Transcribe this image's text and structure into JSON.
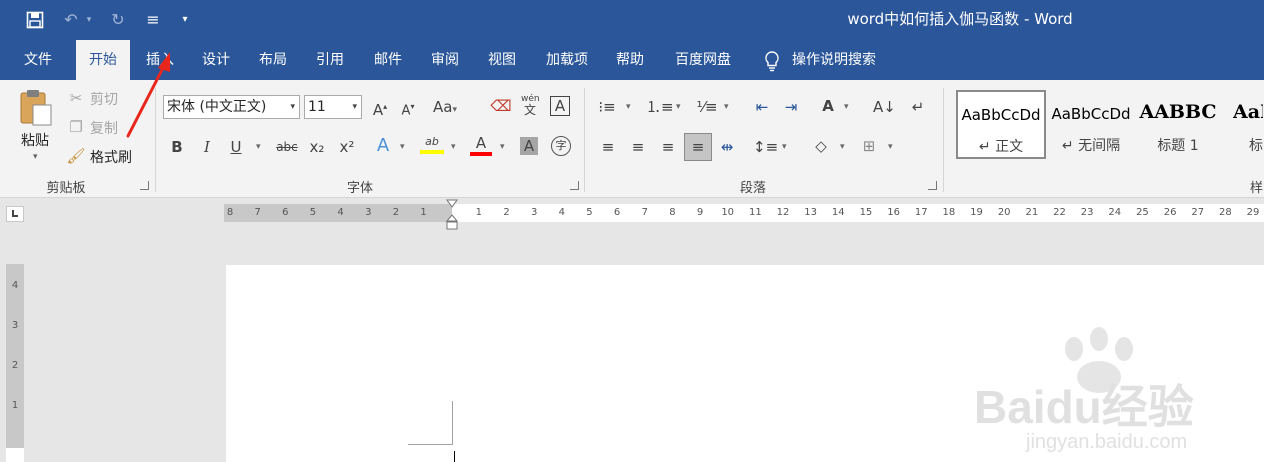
{
  "window": {
    "title": "word中如何插入伽马函数  -  Word"
  },
  "tabs": [
    {
      "label": "文件"
    },
    {
      "label": "开始"
    },
    {
      "label": "插入"
    },
    {
      "label": "设计"
    },
    {
      "label": "布局"
    },
    {
      "label": "引用"
    },
    {
      "label": "邮件"
    },
    {
      "label": "审阅"
    },
    {
      "label": "视图"
    },
    {
      "label": "加载项"
    },
    {
      "label": "帮助"
    },
    {
      "label": "百度网盘"
    }
  ],
  "search": {
    "label": "操作说明搜索",
    "icon": "lightbulb-icon"
  },
  "clipboard": {
    "group_label": "剪贴板",
    "paste": "粘贴",
    "cut": "剪切",
    "copy": "复制",
    "format_painter": "格式刷"
  },
  "font": {
    "group_label": "字体",
    "font_name": "宋体 (中文正文)",
    "font_size": "11",
    "grow": "A",
    "shrink": "A",
    "change_case": "Aa",
    "phonetic_top": "wén",
    "phonetic_bottom": "文",
    "border_char": "A",
    "bold": "B",
    "italic": "I",
    "underline": "U",
    "strike": "abc",
    "subscript": "x₂",
    "superscript": "x²",
    "text_effects": "A",
    "highlight": "ab",
    "font_color": "A",
    "char_shading": "A",
    "enclose": "字"
  },
  "paragraph": {
    "group_label": "段落"
  },
  "styles": {
    "group_label": "样",
    "items": [
      {
        "sample": "AaBbCcDd",
        "name": "↵ 正文"
      },
      {
        "sample": "AaBbCcDd",
        "name": "↵ 无间隔"
      },
      {
        "sample": "AABBC",
        "name": "标题 1"
      },
      {
        "sample": "AaB",
        "name": "标"
      }
    ]
  },
  "hruler": {
    "ticks": [
      "8",
      "7",
      "6",
      "5",
      "4",
      "3",
      "2",
      "1",
      "",
      "1",
      "2",
      "3",
      "4",
      "5",
      "6",
      "7",
      "8",
      "9",
      "10",
      "11",
      "12",
      "13",
      "14",
      "15",
      "16",
      "17",
      "18",
      "19",
      "20",
      "21",
      "22",
      "23",
      "24",
      "25",
      "26",
      "27",
      "28",
      "29"
    ]
  },
  "vruler": {
    "ticks": [
      "4",
      "3",
      "2",
      "1"
    ]
  },
  "colors": {
    "brand": "#2b579a",
    "highlight": "#ffff00",
    "font_color": "#ff0000",
    "annotation_arrow": "#e8261b"
  },
  "watermark": {
    "text": "Baidu经验",
    "url": "jingyan.baidu.com"
  }
}
